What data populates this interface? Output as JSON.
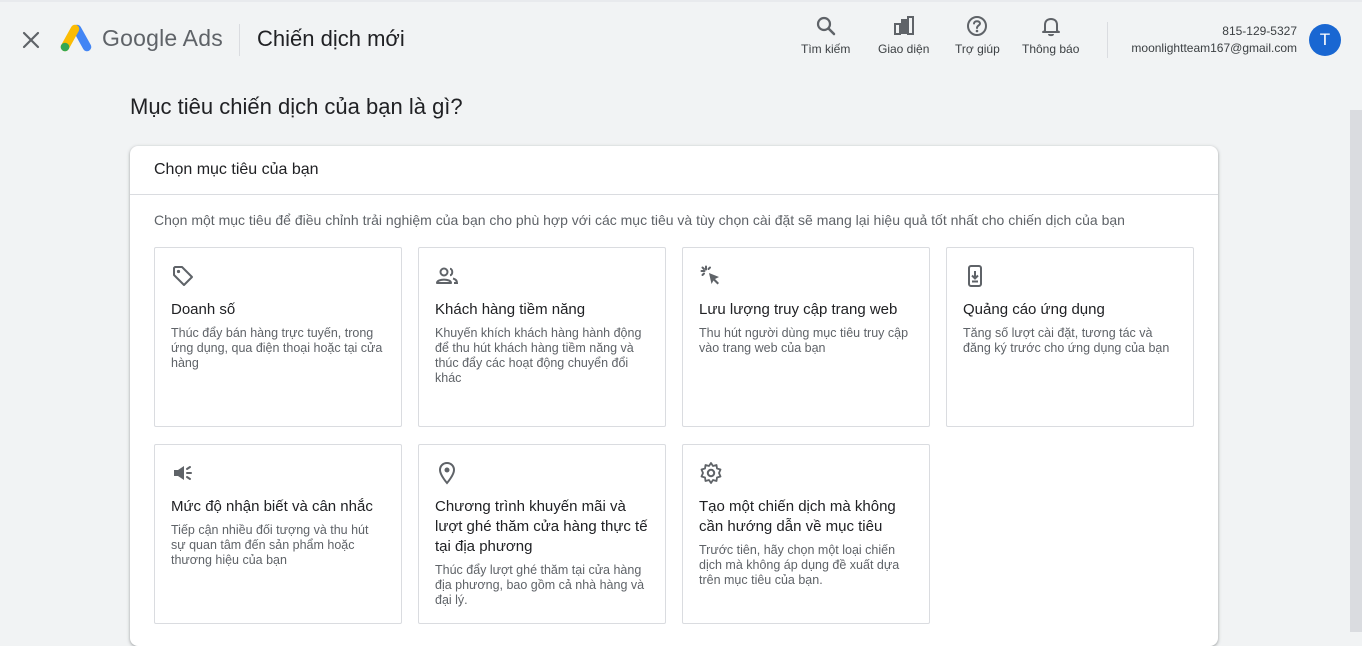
{
  "header": {
    "brand": "Google Ads",
    "page_title": "Chiến dịch mới",
    "actions": [
      {
        "label": "Tìm kiếm",
        "icon": "search-icon"
      },
      {
        "label": "Giao diện",
        "icon": "appearance-icon"
      },
      {
        "label": "Trợ giúp",
        "icon": "help-icon"
      },
      {
        "label": "Thông báo",
        "icon": "bell-icon"
      }
    ],
    "account": {
      "phone": "815-129-5327",
      "email": "moonlightteam167@gmail.com",
      "avatar_letter": "T"
    }
  },
  "main": {
    "question": "Mục tiêu chiến dịch của bạn là gì?",
    "panel_title": "Chọn mục tiêu của bạn",
    "panel_desc": "Chọn một mục tiêu để điều chỉnh trải nghiệm của bạn cho phù hợp với các mục tiêu và tùy chọn cài đặt sẽ mang lại hiệu quả tốt nhất cho chiến dịch của bạn",
    "goals": [
      {
        "title": "Doanh số",
        "desc": "Thúc đẩy bán hàng trực tuyến, trong ứng dụng, qua điện thoại hoặc tại cửa hàng",
        "icon": "tag-icon"
      },
      {
        "title": "Khách hàng tiềm năng",
        "desc": "Khuyến khích khách hàng hành động để thu hút khách hàng tiềm năng và thúc đẩy các hoạt động chuyển đổi khác",
        "icon": "people-icon"
      },
      {
        "title": "Lưu lượng truy cập trang web",
        "desc": "Thu hút người dùng mục tiêu truy cập vào trang web của bạn",
        "icon": "cursor-click-icon"
      },
      {
        "title": "Quảng cáo ứng dụng",
        "desc": "Tăng số lượt cài đặt, tương tác và đăng ký trước cho ứng dụng của bạn",
        "icon": "phone-download-icon"
      },
      {
        "title": "Mức độ nhận biết và cân nhắc",
        "desc": "Tiếp cận nhiều đối tượng và thu hút sự quan tâm đến sản phẩm hoặc thương hiệu của bạn",
        "icon": "megaphone-icon"
      },
      {
        "title": "Chương trình khuyến mãi và lượt ghé thăm cửa hàng thực tế tại địa phương",
        "desc": "Thúc đẩy lượt ghé thăm tại cửa hàng địa phương, bao gồm cả nhà hàng và đại lý.",
        "icon": "location-pin-icon"
      },
      {
        "title": "Tạo một chiến dịch mà không cần hướng dẫn về mục tiêu",
        "desc": "Trước tiên, hãy chọn một loại chiến dịch mà không áp dụng đề xuất dựa trên mục tiêu của bạn.",
        "icon": "gear-icon"
      }
    ]
  },
  "colors": {
    "background": "#f1f3f4",
    "avatar": "#1967d2",
    "icon": "#5f6368",
    "logo_blue": "#4285f4",
    "logo_yellow": "#fbbc04",
    "logo_green": "#34a853"
  }
}
